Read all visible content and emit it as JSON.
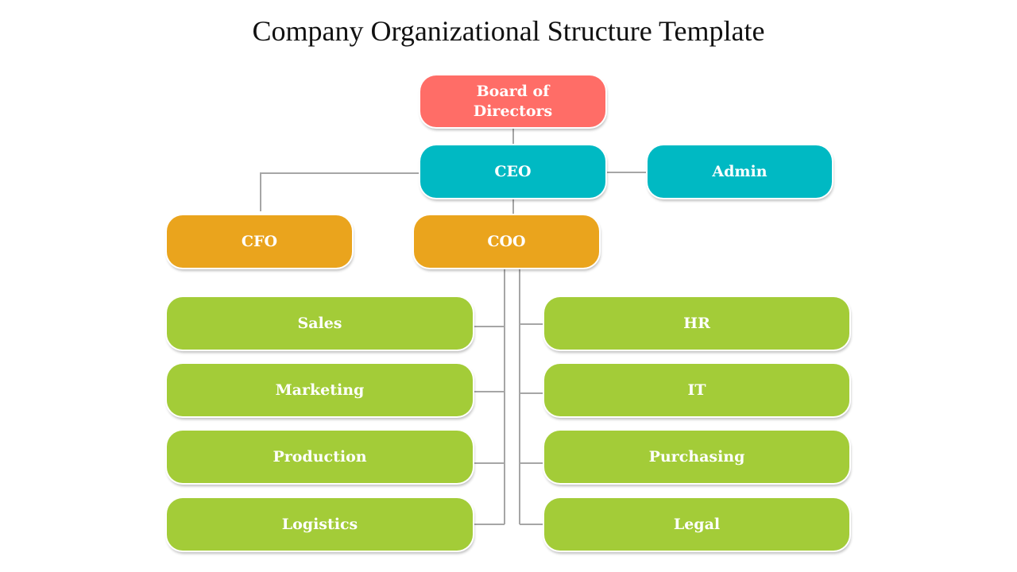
{
  "title": "Company Organizational Structure Template",
  "colors": {
    "board": "#ff6d67",
    "executive": "#00b9c3",
    "officer": "#eaa41d",
    "department": "#a3cc38",
    "connector": "#a6a6a6"
  },
  "nodes": {
    "board": "Board of\nDirectors",
    "ceo": "CEO",
    "admin": "Admin",
    "cfo": "CFO",
    "coo": "COO"
  },
  "departments": {
    "left": [
      "Sales",
      "Marketing",
      "Production",
      "Logistics"
    ],
    "right": [
      "HR",
      "IT",
      "Purchasing",
      "Legal"
    ]
  }
}
